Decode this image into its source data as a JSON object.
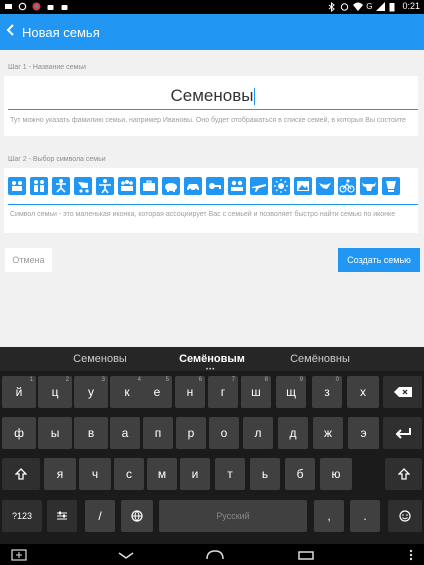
{
  "status": {
    "time": "0:21"
  },
  "appbar": {
    "title": "Новая семья"
  },
  "step1": {
    "label": "Шаг 1 - Название семьи",
    "value": "Семеновы",
    "hint": "Тут можно указать фамилию семьи, например Ивановы. Оно будет отображаться в списке семей, в которых Вы состоите"
  },
  "step2": {
    "label": "Шаг 2 - Выбор символа семьи",
    "hint": "Символ семьи - это маленькая иконка, которая ассоциирует Вас с семьей и позволяет быстро найти семью по иконке",
    "icons": [
      "family-icon",
      "couple-icon",
      "soccer-icon",
      "stroller-icon",
      "kids-icon",
      "group-icon",
      "briefcase-icon",
      "piggy-bank-icon",
      "car-icon",
      "key-icon",
      "people-icon",
      "plane-icon",
      "sun-icon",
      "photo-icon",
      "bird-icon",
      "cyclist-icon",
      "bull-icon",
      "cup-icon"
    ]
  },
  "buttons": {
    "cancel": "Отмена",
    "create": "Создать семью"
  },
  "keyboard": {
    "suggestions": [
      "Семеновы",
      "Семёновым",
      "Семёновны"
    ],
    "row1": [
      {
        "k": "й",
        "n": "1"
      },
      {
        "k": "ц",
        "n": "2"
      },
      {
        "k": "у",
        "n": "3"
      },
      {
        "k": "к",
        "n": "4"
      },
      {
        "k": "е",
        "n": "5"
      },
      {
        "k": "н",
        "n": "6"
      },
      {
        "k": "г",
        "n": "7"
      },
      {
        "k": "ш",
        "n": "8"
      },
      {
        "k": "щ",
        "n": "9"
      },
      {
        "k": "з",
        "n": "0"
      },
      {
        "k": "х",
        "n": ""
      }
    ],
    "row2": [
      "ф",
      "ы",
      "в",
      "а",
      "п",
      "р",
      "о",
      "л",
      "д",
      "ж",
      "э"
    ],
    "row3": [
      "я",
      "ч",
      "с",
      "м",
      "и",
      "т",
      "ь",
      "б",
      "ю"
    ],
    "bottom": {
      "symbols": "?123",
      "slash": "/",
      "space": "Русский",
      "comma": ",",
      "period": "."
    }
  }
}
